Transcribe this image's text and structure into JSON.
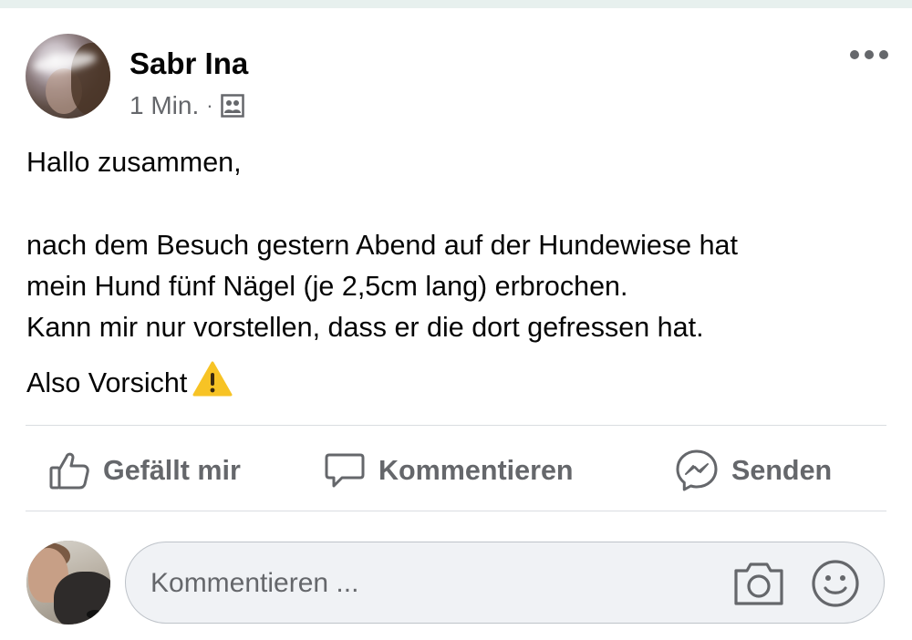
{
  "post": {
    "author": "Sabr Ina",
    "time": "1 Min.",
    "separator": "·",
    "audience_icon": "group-audience-icon",
    "more_icon": "more-options-icon",
    "text": {
      "greeting": "Hallo zusammen,",
      "line1": "nach dem Besuch gestern Abend auf der Hundewiese hat",
      "line2": "mein Hund fünf Nägel (je 2,5cm lang) erbrochen.",
      "line3": "Kann mir nur vorstellen, dass er die dort gefressen hat.",
      "line4": "Also Vorsicht",
      "emoji": "warning-emoji"
    }
  },
  "actions": {
    "like": {
      "label": "Gefällt mir",
      "icon": "thumbs-up-icon"
    },
    "comment": {
      "label": "Kommentieren",
      "icon": "comment-bubble-icon"
    },
    "send": {
      "label": "Senden",
      "icon": "messenger-icon"
    }
  },
  "composer": {
    "placeholder": "Kommentieren ...",
    "camera_icon": "camera-icon",
    "emoji_icon": "smiley-icon"
  },
  "colors": {
    "text": "#050505",
    "secondary": "#65676b",
    "divider": "#dadde1",
    "input_bg": "#f0f2f5",
    "warning": "#f7c325"
  }
}
